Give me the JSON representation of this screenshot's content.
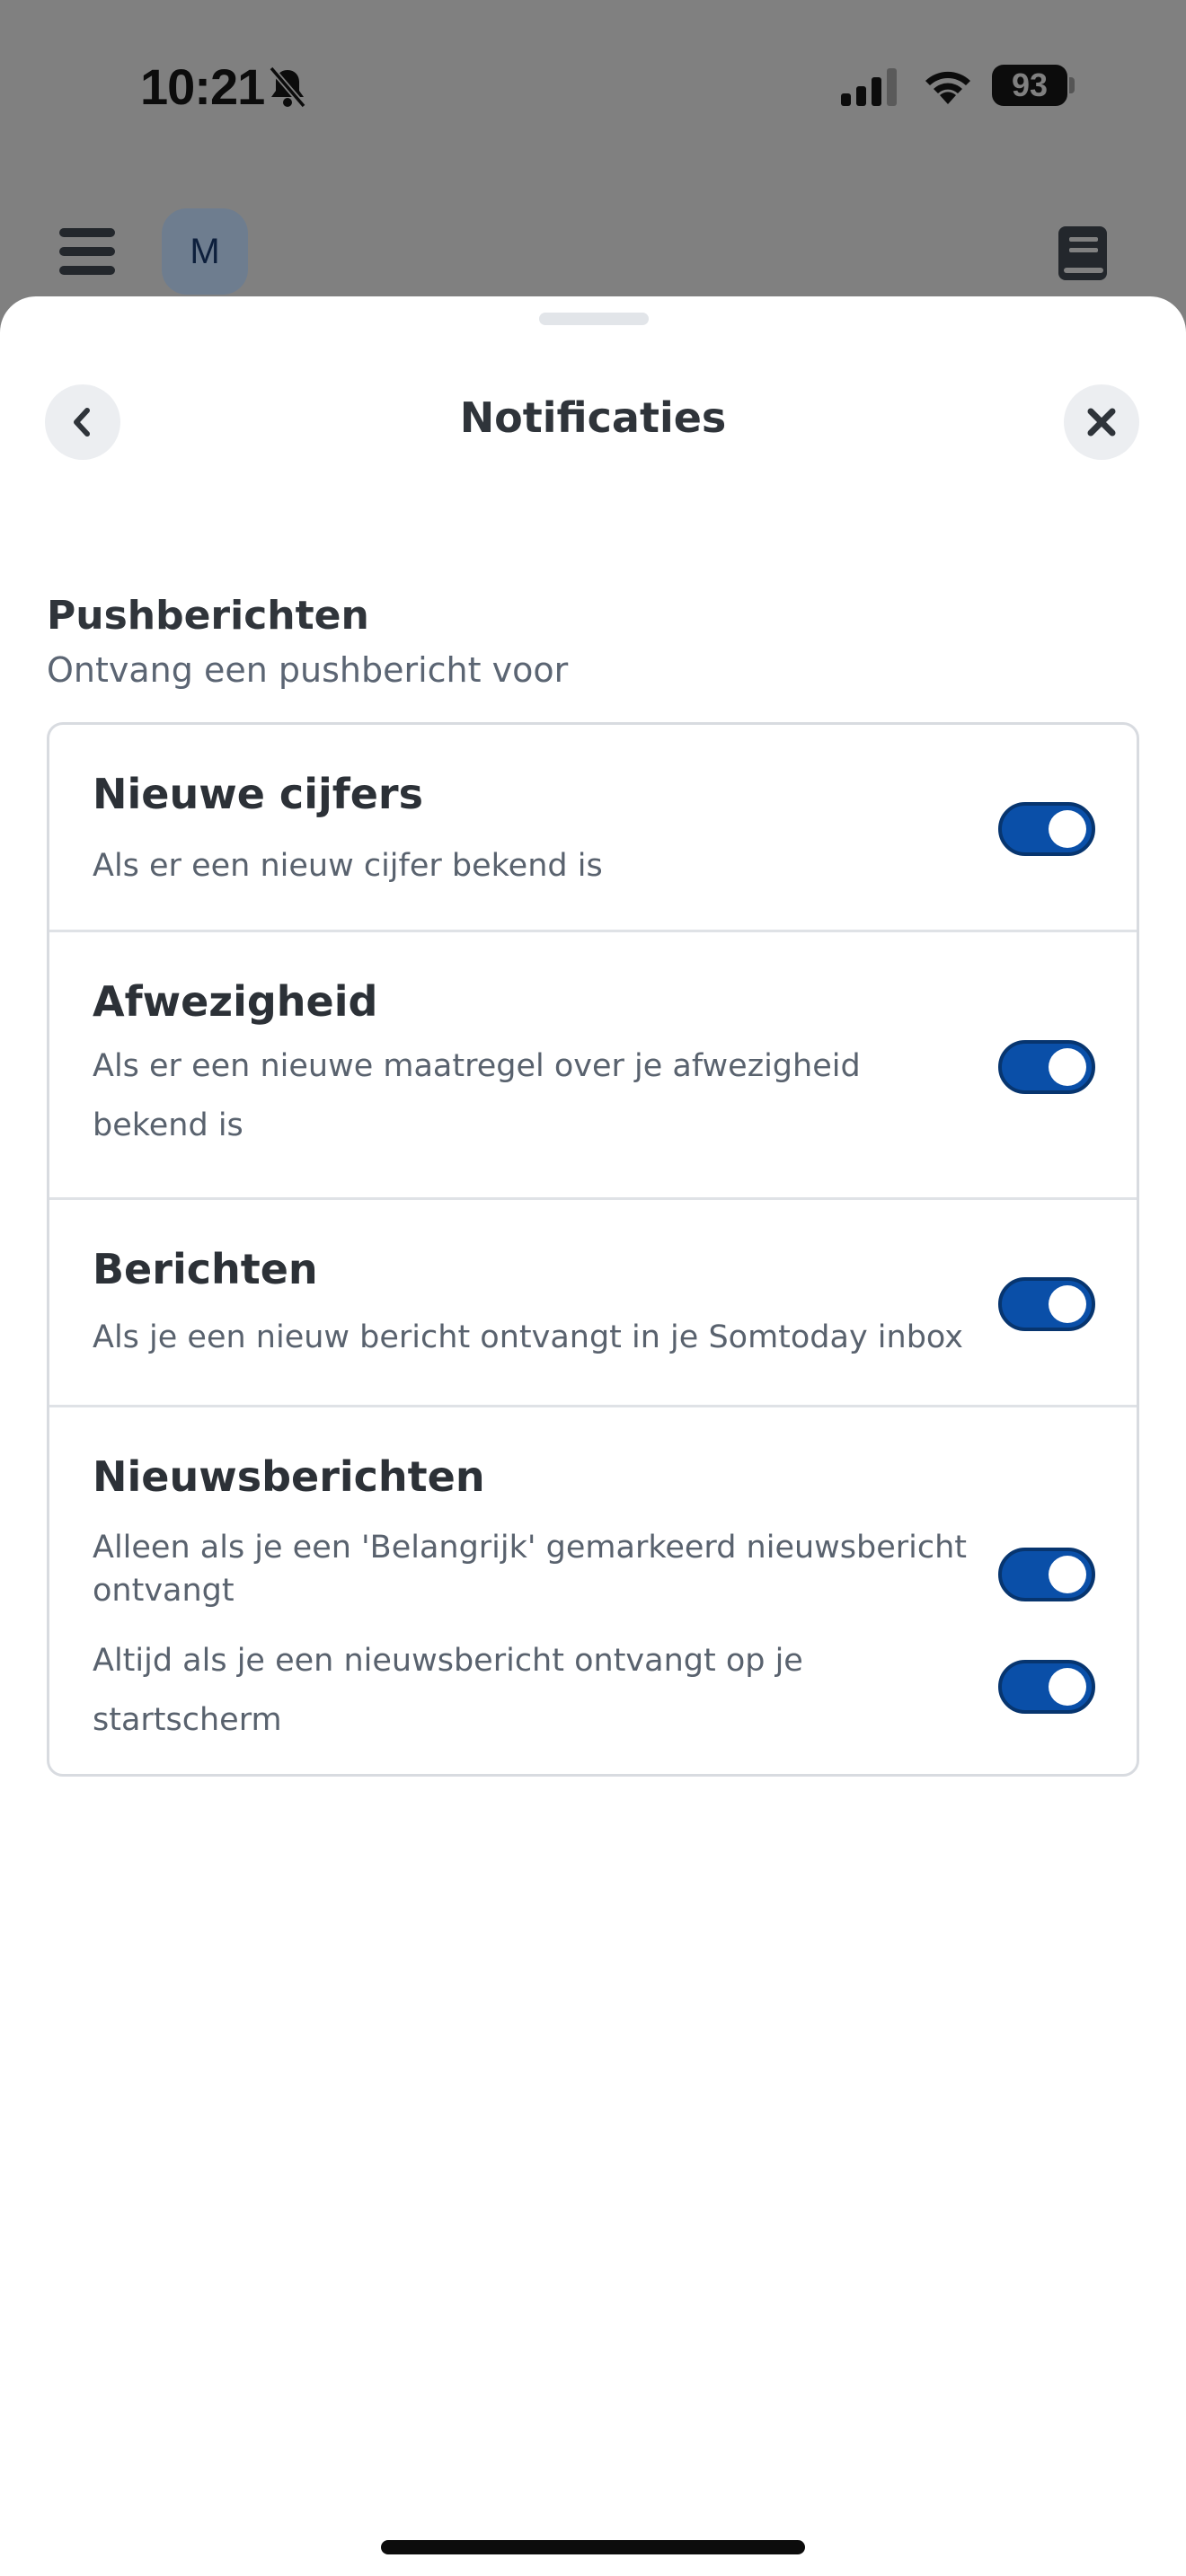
{
  "status_bar": {
    "time": "10:21",
    "battery": "93",
    "icons": [
      "bell-slash-icon",
      "signal-icon",
      "wifi-icon",
      "battery-icon"
    ]
  },
  "header": {
    "avatar_initial": "M",
    "icons": [
      "menu-icon",
      "book-icon"
    ]
  },
  "sheet": {
    "title": "Notificaties",
    "back_icon": "chevron-left-icon",
    "close_icon": "close-icon"
  },
  "section": {
    "title": "Pushberichten",
    "subtitle": "Ontvang een pushbericht voor"
  },
  "settings": [
    {
      "title": "Nieuwe cijfers",
      "description": "Als er een nieuw cijfer bekend is",
      "enabled": true
    },
    {
      "title": "Afwezigheid",
      "description": "Als er een nieuwe maatregel over je afwezigheid bekend is",
      "enabled": true
    },
    {
      "title": "Berichten",
      "description": "Als je een nieuw bericht ontvangt in je Somtoday inbox",
      "enabled": true
    },
    {
      "title": "Nieuwsberichten",
      "options": [
        {
          "description": "Alleen als je een 'Belangrijk' gemarkeerd nieuwsbericht ontvangt",
          "enabled": true
        },
        {
          "description": "Altijd als je een nieuwsbericht ontvangt op je startscherm",
          "enabled": true
        }
      ]
    }
  ],
  "colors": {
    "toggle_on": "#0a4fa8",
    "overlay": "#808080",
    "sheet": "#ffffff"
  }
}
